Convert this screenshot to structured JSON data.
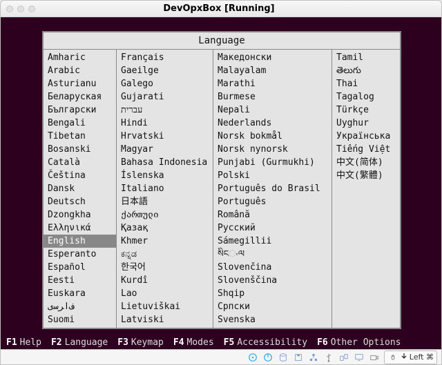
{
  "window": {
    "title": "DevOpxBox [Running]"
  },
  "panel": {
    "header": "Language",
    "selected": "English",
    "columns": [
      [
        "Amharic",
        "Arabic",
        "Asturianu",
        "Беларуская",
        "Български",
        "Bengali",
        "Tibetan",
        "Bosanski",
        "Català",
        "Čeština",
        "Dansk",
        "Deutsch",
        "Dzongkha",
        "Ελληνικά",
        "English",
        "Esperanto",
        "Español",
        "Eesti",
        "Euskara",
        "ﻑﺍﺮﺳی",
        "Suomi"
      ],
      [
        "Français",
        "Gaeilge",
        "Galego",
        "Gujarati",
        "עברית",
        "Hindi",
        "Hrvatski",
        "Magyar",
        "Bahasa Indonesia",
        "Íslenska",
        "Italiano",
        "日本語",
        "ქართული",
        "Қазақ",
        "Khmer",
        "ಕನ್ನಡ",
        "한국어",
        "Kurdî",
        "Lao",
        "Lietuviškai",
        "Latviski"
      ],
      [
        "Македонски",
        "Malayalam",
        "Marathi",
        "Burmese",
        "Nepali",
        "Nederlands",
        "Norsk bokmål",
        "Norsk nynorsk",
        "Punjabi (Gurmukhi)",
        "Polski",
        "Português do Brasil",
        "Português",
        "Română",
        "Русский",
        "Sámegillii",
        "སིངංལ",
        "Slovenčina",
        "Slovenščina",
        "Shqip",
        "Српски",
        "Svenska"
      ],
      [
        "Tamil",
        "తెలుగు",
        "Thai",
        "Tagalog",
        "Türkçe",
        "Uyghur",
        "Українська",
        "Tiếng Việt",
        "中文(简体)",
        "中文(繁體)"
      ]
    ]
  },
  "fkeys": [
    {
      "key": "F1",
      "label": "Help"
    },
    {
      "key": "F2",
      "label": "Language"
    },
    {
      "key": "F3",
      "label": "Keymap"
    },
    {
      "key": "F4",
      "label": "Modes"
    },
    {
      "key": "F5",
      "label": "Accessibility"
    },
    {
      "key": "F6",
      "label": "Other Options"
    }
  ],
  "status": {
    "indicators": [
      {
        "icon": "disc",
        "color": "#3daee9"
      },
      {
        "icon": "power",
        "color": "#3daee9"
      },
      {
        "icon": "disk",
        "color": "#7a9bd1"
      },
      {
        "icon": "floppy",
        "color": "#7a9bd1"
      },
      {
        "icon": "network",
        "color": "#7a9bd1"
      },
      {
        "icon": "usb",
        "color": "#888"
      },
      {
        "icon": "share",
        "color": "#7a9bd1"
      },
      {
        "icon": "display",
        "color": "#7a9bd1"
      },
      {
        "icon": "camera",
        "color": "#888"
      },
      {
        "icon": "mouse-capture",
        "color": "#333"
      }
    ],
    "capture_label": "Left ⌘"
  }
}
